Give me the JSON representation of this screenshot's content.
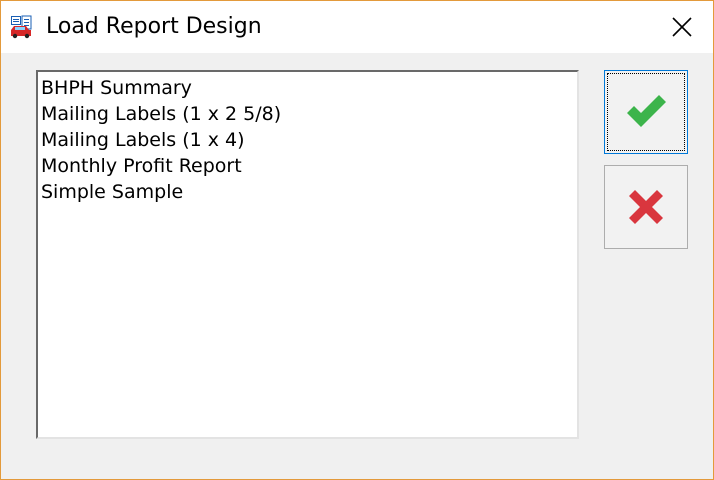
{
  "window": {
    "title": "Load Report Design",
    "icon": "report-app-icon",
    "close_icon": "close-icon"
  },
  "report_list": {
    "items": [
      "BHPH Summary",
      "Mailing Labels (1 x 2 5/8)",
      "Mailing Labels (1 x 4)",
      "Monthly Profit Report",
      "Simple Sample"
    ]
  },
  "buttons": {
    "ok": {
      "icon": "checkmark-icon",
      "color": "#3cb44b"
    },
    "cancel": {
      "icon": "x-mark-icon",
      "color": "#d9363e"
    }
  },
  "colors": {
    "window_border": "#e39a3b",
    "title_background": "#ffffff",
    "client_background": "#f0f0f0"
  }
}
